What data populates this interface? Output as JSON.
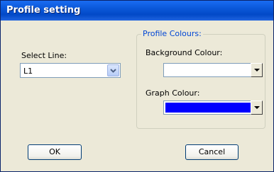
{
  "window": {
    "title": "Profile setting"
  },
  "line": {
    "label": "Select Line:",
    "value": "L1"
  },
  "colours": {
    "group_label": "Profile Colours:",
    "background_label": "Background Colour:",
    "background_color": "#ffffff",
    "graph_label": "Graph Colour:",
    "graph_color": "#0000ff"
  },
  "buttons": {
    "ok": "OK",
    "cancel": "Cancel"
  }
}
